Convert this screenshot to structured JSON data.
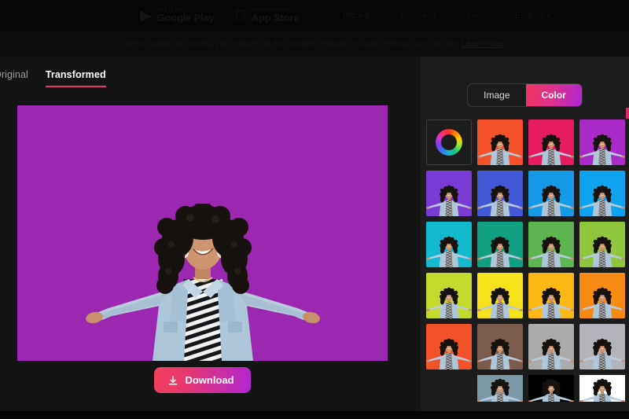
{
  "topnav": {
    "stores": [
      {
        "small_label": "GET IT ON",
        "big_label": "Google Play",
        "icon": "google-play-icon"
      },
      {
        "small_label": "Download on the",
        "big_label": "App Store",
        "icon": "apple-icon"
      }
    ],
    "links": [
      "Pricing",
      "Business",
      "Help"
    ],
    "language": {
      "label": "English",
      "caret": "▾"
    }
  },
  "banner": {
    "text": "We're unable to process your request at the moment. Please try again. Please use Chrome",
    "link_text": "Learn more"
  },
  "editor": {
    "tabs": [
      {
        "label": "Original",
        "active": false
      },
      {
        "label": "Transformed",
        "active": true
      }
    ],
    "canvas": {
      "background_color": "#9c27b0",
      "subject": "woman-arms-outstretched"
    },
    "download_button": {
      "label": "Download",
      "icon": "download-icon"
    }
  },
  "panel": {
    "mode_toggle": {
      "options": [
        "Image",
        "Color"
      ],
      "selected": "Color"
    },
    "picker": {
      "name": "color-wheel",
      "label": "Custom color"
    },
    "swatches": [
      "#f4502a",
      "#e61a5f",
      "#a92ac7",
      "#7a3ad6",
      "#4358d6",
      "#159ae8",
      "#0fa2ef",
      "#12b9cf",
      "#11a081",
      "#5eb450",
      "#8fc63d",
      "#c3d92b",
      "#f7e21c",
      "#fbb714",
      "#f78a14",
      "#f2512a",
      "#7a5b4c",
      "#ababab",
      "#b3b3bb"
    ],
    "bottom_swatches": [
      "#7b97a6",
      "#000000",
      "#ffffff"
    ]
  },
  "theme": {
    "accent_pink": "#e8386d",
    "accent_purple": "#b026d3",
    "panel_bg": "#1c1c1c",
    "app_bg": "#141414"
  }
}
